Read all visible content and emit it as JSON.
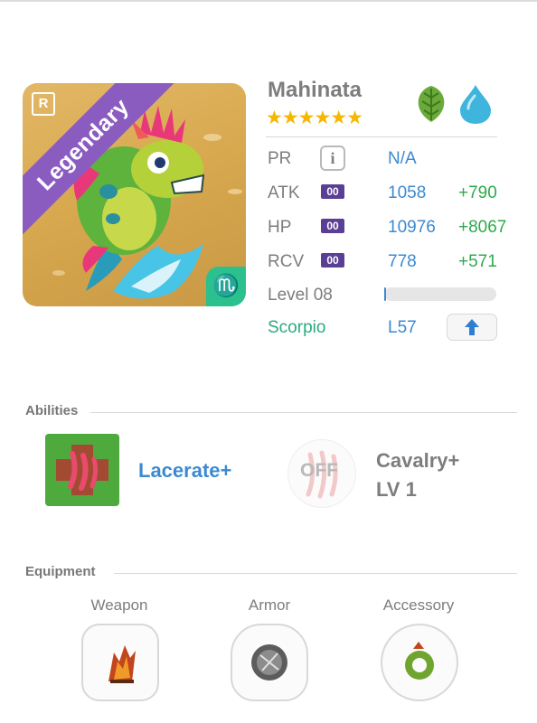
{
  "hero": {
    "name": "Mahinata",
    "rarity": "Legendary",
    "r_badge": "R",
    "stars": "★★★★★★",
    "star_count": 6,
    "elements": [
      "leaf-icon",
      "water-drop-icon"
    ],
    "sign_symbol": "♏"
  },
  "stats": {
    "pr": {
      "label": "PR",
      "value": "N/A"
    },
    "atk": {
      "label": "ATK",
      "tag": "00",
      "value": "1058",
      "bonus": "+790"
    },
    "hp": {
      "label": "HP",
      "tag": "00",
      "value": "10976",
      "bonus": "+8067"
    },
    "rcv": {
      "label": "RCV",
      "tag": "00",
      "value": "778",
      "bonus": "+571"
    },
    "level": {
      "label": "Level 08",
      "progress": 0.02
    },
    "sign": {
      "name": "Scorpio",
      "level": "L57"
    }
  },
  "abilities": {
    "title": "Abilities",
    "primary": {
      "name": "Lacerate+"
    },
    "secondary": {
      "status": "OFF",
      "name_line1": "Cavalry+",
      "name_line2": "LV 1"
    }
  },
  "equipment": {
    "title": "Equipment",
    "slots": [
      {
        "label": "Weapon"
      },
      {
        "label": "Armor"
      },
      {
        "label": "Accessory"
      }
    ]
  },
  "colors": {
    "accent_blue": "#3d89d1",
    "bonus_green": "#2eaa4d",
    "legendary_purple": "#8a5cc0",
    "star_gold": "#f6b700",
    "scorpio_teal": "#2aac7e"
  }
}
